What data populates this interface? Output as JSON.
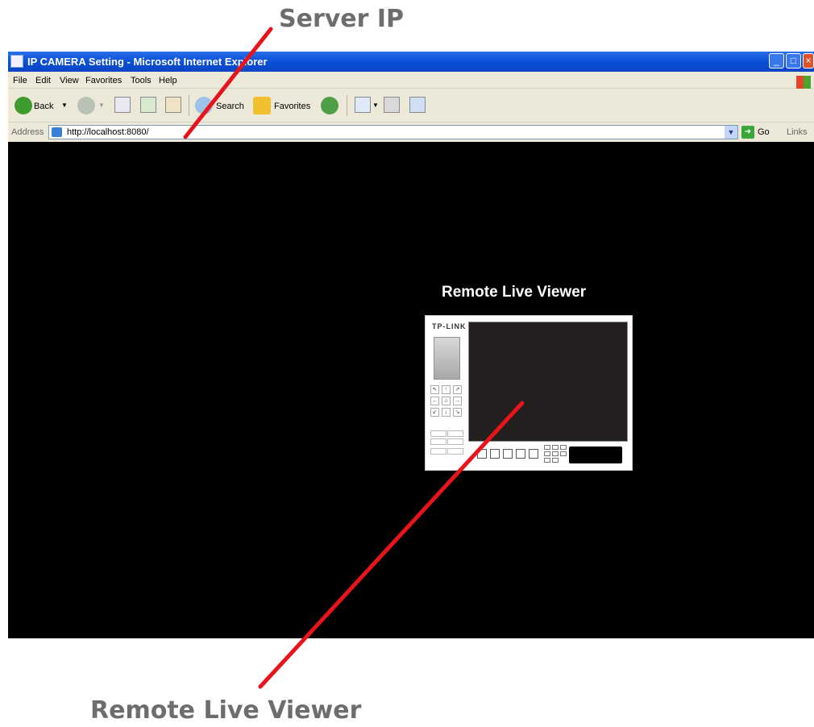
{
  "callouts": {
    "top": "Server IP",
    "bottom": "Remote Live Viewer"
  },
  "window": {
    "title": "IP CAMERA Setting - Microsoft Internet Explorer"
  },
  "menu": [
    "File",
    "Edit",
    "View",
    "Favorites",
    "Tools",
    "Help"
  ],
  "toolbar": {
    "back": "Back",
    "search": "Search",
    "favorites": "Favorites"
  },
  "address": {
    "label": "Address",
    "url": "http://localhost:8080/",
    "go": "Go",
    "links": "Links"
  },
  "content": {
    "heading": "Remote Live Viewer",
    "viewer": {
      "brand": "TP-LINK"
    }
  },
  "colors": {
    "annotation_line": "#e8131b",
    "titlebar": "#0a4fd6",
    "page_background": "#000000"
  },
  "icons": [
    "back-icon",
    "forward-icon",
    "stop-icon",
    "refresh-icon",
    "home-icon",
    "search-icon",
    "favorites-star-icon",
    "history-icon",
    "mail-icon",
    "print-icon",
    "edit-icon",
    "go-icon"
  ]
}
